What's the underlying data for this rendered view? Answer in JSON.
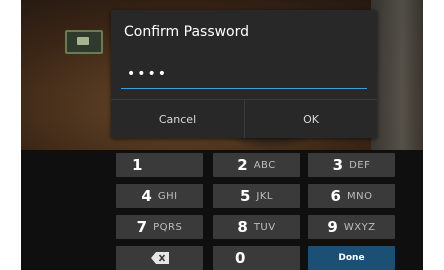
{
  "dialog": {
    "title": "Confirm Password",
    "password_masked": "••••",
    "cancel_label": "Cancel",
    "ok_label": "OK"
  },
  "keyboard": {
    "keys": [
      {
        "num": "1",
        "letters": ""
      },
      {
        "num": "2",
        "letters": "ABC"
      },
      {
        "num": "3",
        "letters": "DEF"
      },
      {
        "num": "4",
        "letters": "GHI"
      },
      {
        "num": "5",
        "letters": "JKL"
      },
      {
        "num": "6",
        "letters": "MNO"
      },
      {
        "num": "7",
        "letters": "PQRS"
      },
      {
        "num": "8",
        "letters": "TUV"
      },
      {
        "num": "9",
        "letters": "WXYZ"
      },
      {
        "num": "",
        "letters": ""
      },
      {
        "num": "0",
        "letters": ""
      },
      {
        "num": "Done",
        "letters": ""
      }
    ]
  },
  "colors": {
    "accent_blue": "#3aa0d8",
    "done_key": "#1b4f73",
    "key_bg": "#3a3a3a",
    "dialog_bg": "#282828"
  }
}
